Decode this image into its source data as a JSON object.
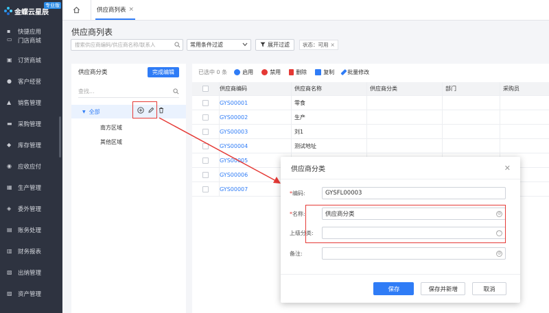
{
  "brand": {
    "name": "金蝶云星辰",
    "edition": "专业版"
  },
  "sidebar": {
    "items": [
      {
        "label": "快捷应用",
        "icon": "grid-icon"
      },
      {
        "label": "门店商城",
        "icon": "store-icon"
      },
      {
        "label": "订货商城",
        "icon": "bag-icon"
      },
      {
        "label": "客户经营",
        "icon": "user-icon"
      },
      {
        "label": "销售管理",
        "icon": "chart-icon"
      },
      {
        "label": "采购管理",
        "icon": "cart-icon"
      },
      {
        "label": "库存管理",
        "icon": "box-icon"
      },
      {
        "label": "应收应付",
        "icon": "money-icon"
      },
      {
        "label": "生产管理",
        "icon": "factory-icon"
      },
      {
        "label": "委外管理",
        "icon": "handshake-icon"
      },
      {
        "label": "账务处理",
        "icon": "ledger-icon"
      },
      {
        "label": "财务报表",
        "icon": "report-icon"
      },
      {
        "label": "出纳管理",
        "icon": "cashier-icon"
      },
      {
        "label": "资产管理",
        "icon": "asset-icon"
      }
    ]
  },
  "tabs": {
    "active": "供应商列表"
  },
  "page": {
    "title": "供应商列表",
    "search_placeholder": "搜索供应商编码/供应商名称/联系人",
    "filter_select": "常用条件过滤",
    "expand_filter": "展开过滤",
    "status_chip": "状态：可用"
  },
  "tree": {
    "title": "供应商分类",
    "finish_edit": "完成编辑",
    "search_placeholder": "查找...",
    "root": "全部",
    "children": [
      "南方区域",
      "其他区域"
    ]
  },
  "toolbar": {
    "selected": "已选中 0 条",
    "enable": "启用",
    "disable": "禁用",
    "delete": "删除",
    "copy": "复制",
    "batch_edit": "批量修改"
  },
  "grid": {
    "headers": {
      "code": "供应商编码",
      "name": "供应商名称",
      "cls": "供应商分类",
      "dept": "部门",
      "buyer": "采购员"
    },
    "rows": [
      {
        "code": "GYS00001",
        "name": "零食"
      },
      {
        "code": "GYS00002",
        "name": "生产"
      },
      {
        "code": "GYS00003",
        "name": "刘1"
      },
      {
        "code": "GYS00004",
        "name": "测试地址"
      },
      {
        "code": "GYS00005",
        "name": ""
      },
      {
        "code": "GYS00006",
        "name": ""
      },
      {
        "code": "GYS00007",
        "name": ""
      }
    ]
  },
  "modal": {
    "title": "供应商分类",
    "code_label": "编码:",
    "code_value": "GYSFL00003",
    "name_label": "名称:",
    "name_value": "供应商分类",
    "parent_label": "上级分类:",
    "parent_value": "",
    "remark_label": "备注:",
    "remark_value": "",
    "save": "保存",
    "save_new": "保存并新增",
    "cancel": "取消"
  },
  "colors": {
    "accent": "#2f7cf6",
    "annotation": "#e53935",
    "sidebar": "#2e3340"
  }
}
